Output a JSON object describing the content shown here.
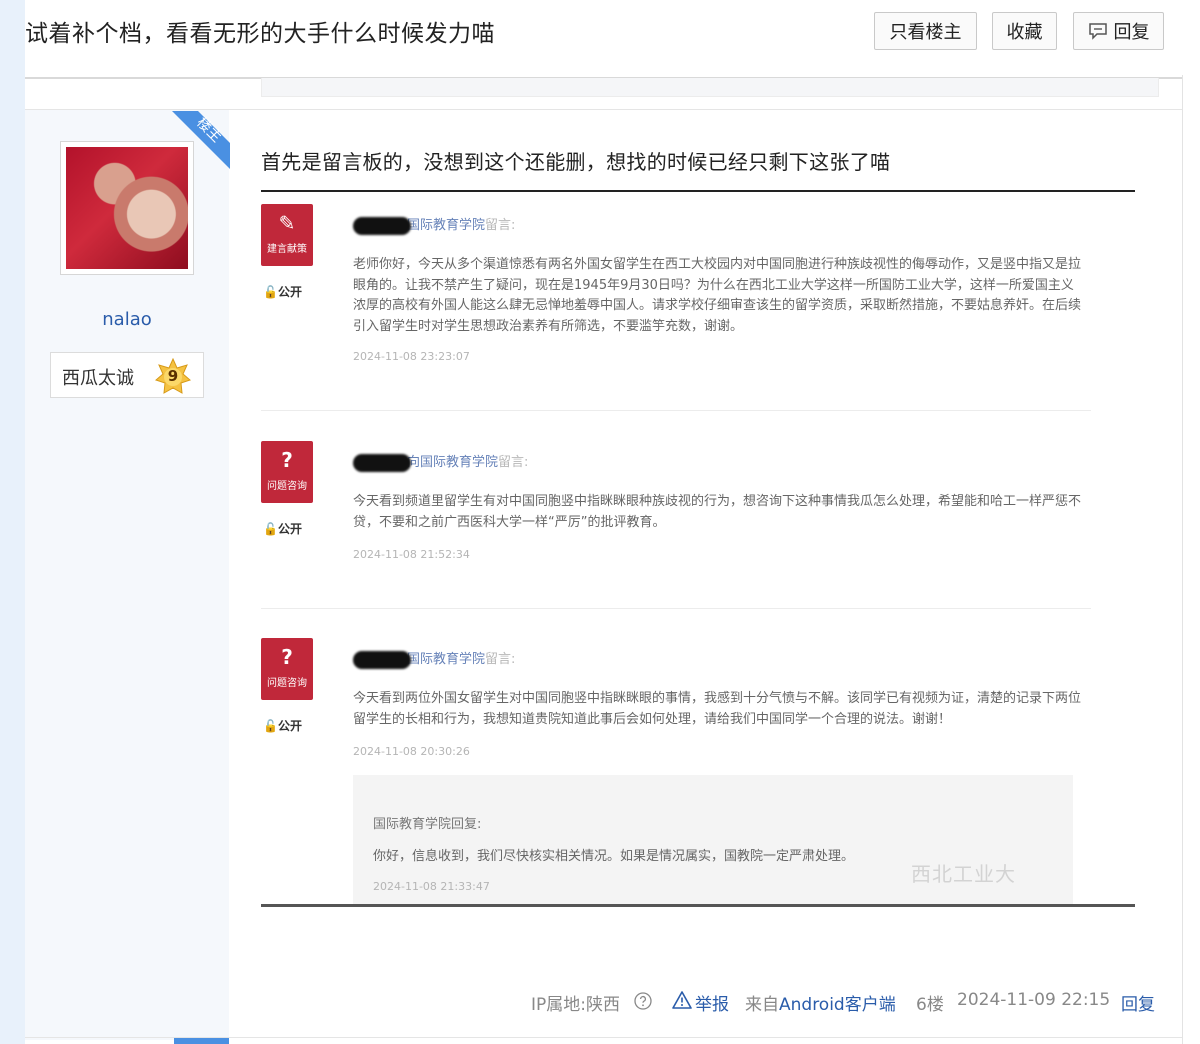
{
  "thread": {
    "title": "试着补个档，看看无形的大手什么时候发力喵",
    "buttons": {
      "only_op": "只看楼主",
      "favorite": "收藏",
      "reply": "回复"
    }
  },
  "author": {
    "op_badge": "楼主",
    "username": "nalao",
    "level_name": "西瓜太诚",
    "level": "9"
  },
  "post": {
    "text": "首先是留言板的，没想到这个还能删，想找的时候已经只剩下这张了喵",
    "image": {
      "messages": [
        {
          "icon_glyph": "✎",
          "category": "建言献策",
          "visibility": "公开",
          "author_suffix": "国际教育学院",
          "action": "留言:",
          "body": "老师你好，今天从多个渠道惊悉有两名外国女留学生在西工大校园内对中国同胞进行种族歧视性的侮辱动作，又是竖中指又是拉眼角的。让我不禁产生了疑问，现在是1945年9月30日吗？为什么在西北工业大学这样一所国防工业大学，这样一所爱国主义浓厚的高校有外国人能这么肆无忌惮地羞辱中国人。请求学校仔细审查该生的留学资质，采取断然措施，不要姑息养奸。在后续引入留学生时对学生思想政治素养有所筛选，不要滥竽充数，谢谢。",
          "time": "2024-11-08 23:23:07"
        },
        {
          "icon_glyph": "?",
          "category": "问题咨询",
          "visibility": "公开",
          "author_suffix": "向国际教育学院",
          "action": "留言:",
          "body": "今天看到频道里留学生有对中国同胞竖中指眯眯眼种族歧视的行为，想咨询下这种事情我瓜怎么处理，希望能和哈工一样严惩不贷，不要和之前广西医科大学一样“严厉”的批评教育。",
          "time": "2024-11-08 21:52:34"
        },
        {
          "icon_glyph": "?",
          "category": "问题咨询",
          "visibility": "公开",
          "author_suffix": "国际教育学院",
          "action": "留言:",
          "body": "今天看到两位外国女留学生对中国同胞竖中指眯眯眼的事情，我感到十分气愤与不解。该同学已有视频为证，清楚的记录下两位留学生的长相和行为，我想知道贵院知道此事后会如何处理，请给我们中国同学一个合理的说法。谢谢！",
          "time": "2024-11-08 20:30:26"
        }
      ],
      "reply": {
        "head": "国际教育学院回复:",
        "body": "你好，信息收到，我们尽快核实相关情况。如果是情况属实，国教院一定严肃处理。",
        "time": "2024-11-08 21:33:47"
      },
      "watermark": "西北工业大"
    }
  },
  "meta": {
    "ip": "IP属地:陕西",
    "report": "举报",
    "source_prefix": "来自",
    "source_link": "Android客户端",
    "floor": "6楼",
    "datetime": "2024-11-09 22:15",
    "reply": "回复"
  },
  "colors": {
    "link": "#2a5caa",
    "op_badge": "#4a90e2",
    "level_badge": "#f5c242",
    "msg_icon": "#c0283a"
  },
  "icons": [
    "reply-icon",
    "pencil-icon",
    "question-icon",
    "unlock-icon",
    "help-icon",
    "warning-icon"
  ]
}
